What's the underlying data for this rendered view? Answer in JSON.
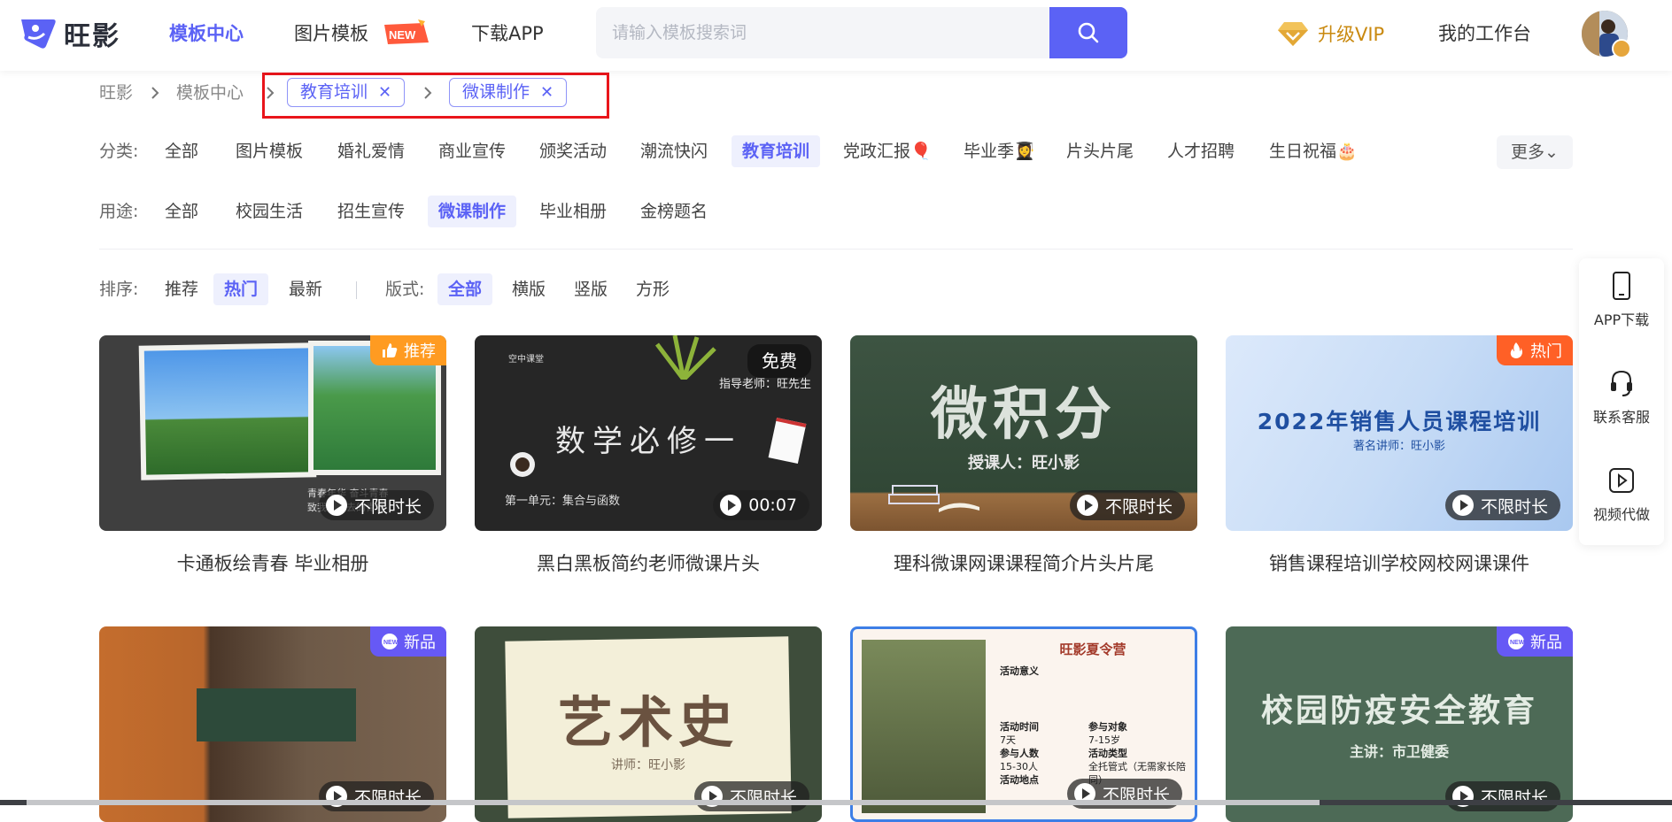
{
  "brand": {
    "name": "旺影"
  },
  "nav": {
    "items": [
      {
        "label": "模板中心",
        "active": true
      },
      {
        "label": "图片模板",
        "badge": "NEW"
      },
      {
        "label": "下载APP"
      }
    ],
    "search_placeholder": "请输入模板搜索词",
    "vip_label": "升级VIP",
    "workspace_label": "我的工作台"
  },
  "breadcrumb": {
    "root": "旺影",
    "section": "模板中心",
    "tags": [
      "教育培训",
      "微课制作"
    ]
  },
  "filters": {
    "category_label": "分类:",
    "category": [
      "全部",
      "图片模板",
      "婚礼爱情",
      "商业宣传",
      "颁奖活动",
      "潮流快闪",
      "教育培训",
      "党政汇报🎈",
      "毕业季👩‍🎓",
      "片头片尾",
      "人才招聘",
      "生日祝福🎂"
    ],
    "category_active": "教育培训",
    "more_label": "更多⌄",
    "usage_label": "用途:",
    "usage": [
      "全部",
      "校园生活",
      "招生宣传",
      "微课制作",
      "毕业相册",
      "金榜题名"
    ],
    "usage_active": "微课制作",
    "sort_label": "排序:",
    "sort": [
      "推荐",
      "热门",
      "最新"
    ],
    "sort_active": "热门",
    "format_label": "版式:",
    "format": [
      "全部",
      "横版",
      "竖版",
      "方形"
    ],
    "format_active": "全部"
  },
  "cards": [
    {
      "title": "卡通板绘青春 毕业相册",
      "duration": "不限时长",
      "corner": "推荐",
      "caption": "青春年华 奋斗青春",
      "caption2": "致我们逝去的青春"
    },
    {
      "title": "黑白黑板简约老师微课片头",
      "duration": "00:07",
      "free": "免费",
      "big": "数学必修一",
      "line1": "第一单元：集合与函数",
      "teacher": "指导老师：旺先生",
      "course": "空中课堂"
    },
    {
      "title": "理科微课网课课程简介片头片尾",
      "duration": "不限时长",
      "big": "微积分",
      "sub": "授课人：旺小影"
    },
    {
      "title": "销售课程培训学校网校网课课件",
      "duration": "不限时长",
      "corner": "热门",
      "big": "2022年销售人员课程培训",
      "sub": "著名讲师：旺小影"
    },
    {
      "duration": "不限时长",
      "corner": "新品"
    },
    {
      "duration": "不限时长",
      "big": "艺术史",
      "sub": "讲师：旺小影"
    },
    {
      "duration": "不限时长",
      "poster_title": "旺影夏令营",
      "poster_rows": [
        "活动意义",
        "活动时间",
        "参与对象",
        "参与人数",
        "活动类型",
        "活动地点"
      ],
      "poster_values": [
        "7天",
        "7-15岁",
        "15-30人",
        "全托管式（无需家长陪同）"
      ]
    },
    {
      "duration": "不限时长",
      "corner": "新品",
      "big": "校园防疫安全教育",
      "sub": "主讲：市卫健委"
    }
  ],
  "side": [
    {
      "label": "APP下载"
    },
    {
      "label": "联系客服"
    },
    {
      "label": "视频代做"
    }
  ],
  "colors": {
    "accent": "#5b62f5",
    "vip": "#c9890f",
    "highlight": "#e9151b"
  }
}
